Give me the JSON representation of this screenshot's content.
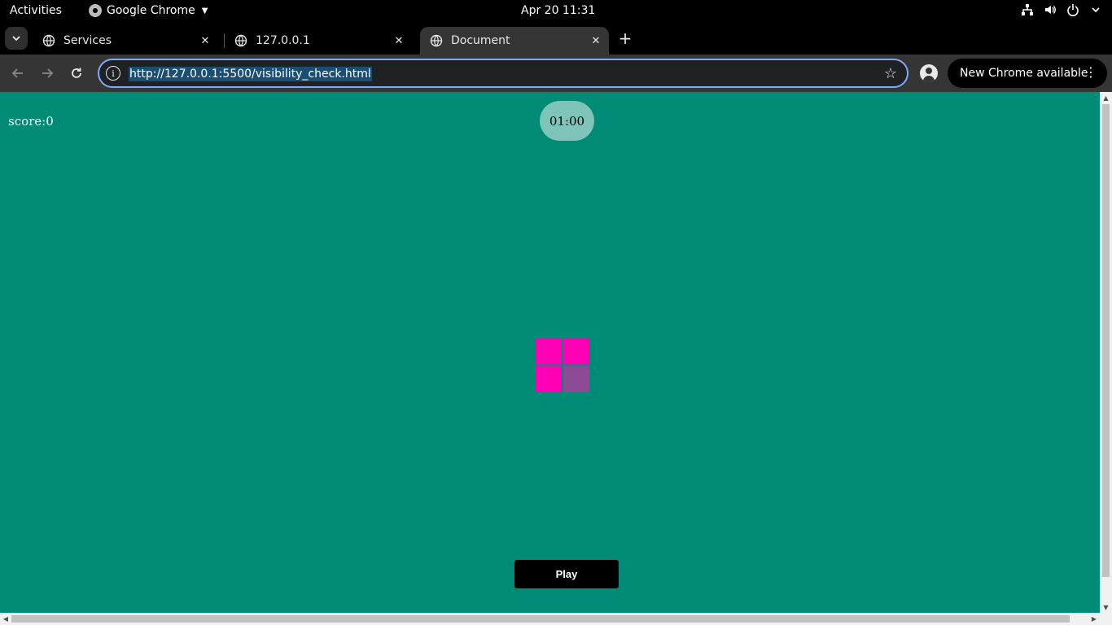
{
  "system_bar": {
    "activities": "Activities",
    "app_name": "Google Chrome",
    "clock": "Apr 20  11:31",
    "tray_icons": [
      "network-icon",
      "volume-icon",
      "power-icon",
      "chevron-down-icon"
    ]
  },
  "tabs": [
    {
      "title": "Services",
      "active": false
    },
    {
      "title": "127.0.0.1",
      "active": false
    },
    {
      "title": "Document",
      "active": true
    }
  ],
  "toolbar": {
    "url": "http://127.0.0.1:5500/visibility_check.html",
    "update_label": "New Chrome available"
  },
  "page": {
    "background": "#008b76",
    "score_text": "score:0",
    "timer": "01:00",
    "grid_colors": [
      "#ff00b4",
      "#ff00b4",
      "#ff00b4",
      "#8e4a95"
    ],
    "play_label": "Play"
  }
}
